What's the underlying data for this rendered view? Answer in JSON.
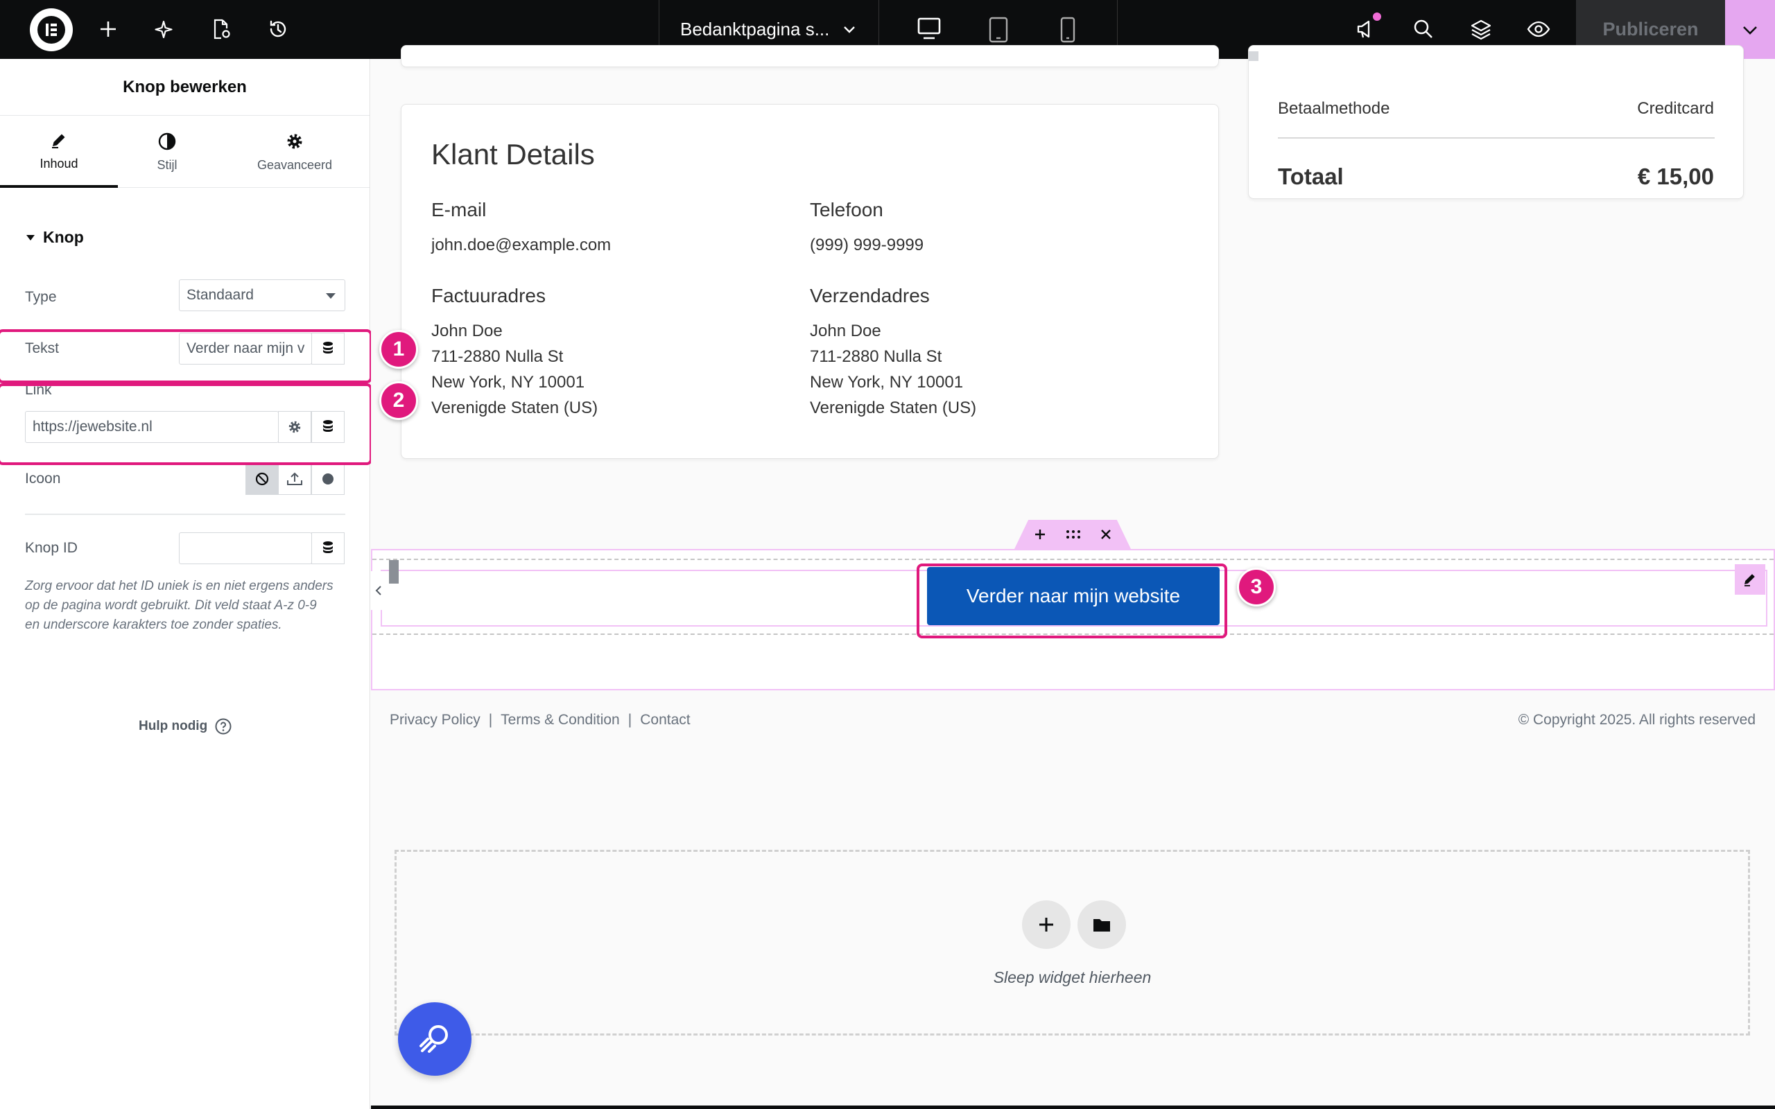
{
  "topbar": {
    "page_name": "Bedanktpagina s...",
    "publish_label": "Publiceren"
  },
  "panel": {
    "title": "Knop bewerken",
    "tabs": [
      {
        "label": "Inhoud",
        "icon": "pencil-icon"
      },
      {
        "label": "Stijl",
        "icon": "half-circle-icon"
      },
      {
        "label": "Geavanceerd",
        "icon": "gear-icon"
      }
    ],
    "section_title": "Knop",
    "type_label": "Type",
    "type_value": "Standaard",
    "text_label": "Tekst",
    "text_value": "Verder naar mijn v",
    "link_label": "Link",
    "link_value": "https://jewebsite.nl",
    "icon_label": "Icoon",
    "id_label": "Knop ID",
    "id_value": "",
    "id_help_1": "Zorg ervoor dat het ID uniek is en niet ergens anders",
    "id_help_2": "op de pagina wordt gebruikt. Dit veld staat A-z  0-9",
    "id_help_3": "en underscore karakters toe zonder spaties.",
    "help_label": "Hulp nodig"
  },
  "annotations": [
    "1",
    "2",
    "3"
  ],
  "canvas": {
    "order_summary": {
      "payment_label": "Betaalmethode",
      "payment_value": "Creditcard",
      "total_label": "Totaal",
      "total_value": "€ 15,00"
    },
    "customer": {
      "title": "Klant Details",
      "email_label": "E-mail",
      "email_value": "john.doe@example.com",
      "phone_label": "Telefoon",
      "phone_value": "(999) 999-9999",
      "billing_label": "Factuuradres",
      "billing_lines": [
        "John Doe",
        "711-2880 Nulla St",
        "New York, NY 10001",
        "Verenigde Staten (US)"
      ],
      "shipping_label": "Verzendadres",
      "shipping_lines": [
        "John Doe",
        "711-2880 Nulla St",
        "New York, NY 10001",
        "Verenigde Staten (US)"
      ]
    },
    "button_label": "Verder naar mijn website",
    "footer": {
      "links": [
        "Privacy Policy",
        "Terms & Condition",
        "Contact"
      ],
      "separator": "|",
      "copyright": "© Copyright 2025. All rights reserved"
    },
    "dropzone_label": "Sleep widget hierheen"
  },
  "colors": {
    "accent": "#e0197d",
    "button": "#0b57b6",
    "topbar": "#0c0d0e",
    "publish_more": "#e5a7f0",
    "section_handle": "#f2c1f6",
    "fab": "#3e5be8"
  }
}
